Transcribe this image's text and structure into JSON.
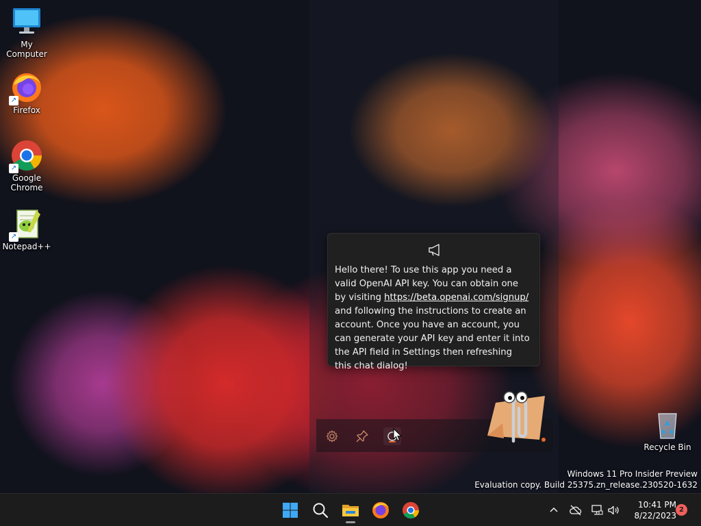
{
  "desktop": {
    "icons": [
      {
        "label": "My Computer",
        "icon": "monitor-icon"
      },
      {
        "label": "Firefox",
        "icon": "firefox-icon"
      },
      {
        "label": "Google Chrome",
        "icon": "chrome-icon"
      },
      {
        "label": "Notepad++",
        "icon": "notepadpp-icon"
      },
      {
        "label": "Recycle Bin",
        "icon": "recycle-bin-icon"
      }
    ]
  },
  "notification": {
    "icon": "megaphone-icon",
    "text_before": "Hello there! To use this app you need a valid OpenAI API key. You can obtain one by visiting ",
    "link": "https://beta.openai.com/signup/",
    "text_after": " and following the instructions to create an account. Once you have an account, you can generate your API key and enter it into the API field in Settings then refreshing this chat dialog!"
  },
  "assistant_toolbar": {
    "buttons": [
      "gear-icon",
      "pin-icon",
      "refresh-icon"
    ]
  },
  "watermark": {
    "line1": "Windows 11 Pro Insider Preview",
    "line2": "Evaluation copy. Build 25375.zn_release.230520-1632"
  },
  "taskbar": {
    "apps": [
      "start-icon",
      "search-icon",
      "file-explorer-icon",
      "firefox-icon",
      "chrome-icon"
    ],
    "tray": [
      "chevron-up-icon",
      "cloud-off-icon",
      "network-icon",
      "volume-icon"
    ],
    "time": "10:41 PM",
    "date": "8/22/2023",
    "notification_count": "2"
  },
  "colors": {
    "taskbar_bg": "#1c1c1c",
    "bubble_bg": "#202020",
    "badge": "#f25f5c",
    "accent_orange": "#e46a2a"
  }
}
